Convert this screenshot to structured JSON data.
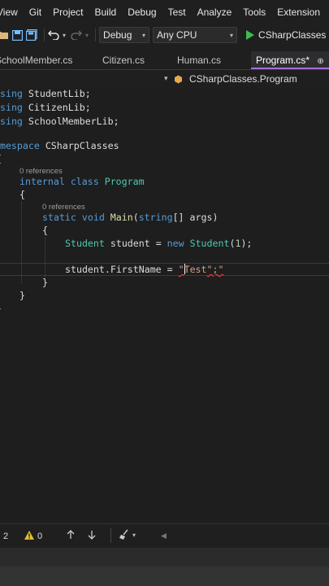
{
  "menu": [
    "View",
    "Git",
    "Project",
    "Build",
    "Debug",
    "Test",
    "Analyze",
    "Tools",
    "Extension"
  ],
  "toolbar": {
    "config": "Debug",
    "platform": "Any CPU",
    "run_target": "CSharpClasses"
  },
  "tabs": [
    {
      "label": "SchoolMember.cs",
      "active": false
    },
    {
      "label": "Citizen.cs",
      "active": false
    },
    {
      "label": "Human.cs",
      "active": false
    },
    {
      "label": "Program.cs*",
      "active": true
    }
  ],
  "tab_pin": "⊕",
  "nav": {
    "type_label": "CSharpClasses.Program"
  },
  "code": {
    "using1_kw": "using",
    "using1_ns": "StudentLib;",
    "using2_kw": "using",
    "using2_ns": "CitizenLib;",
    "using3_kw": "using",
    "using3_ns": "SchoolMemberLib;",
    "ns_kw": "namespace",
    "ns_name": "CSharpClasses",
    "open_brace_1": "{",
    "refs_class": "0 references",
    "class_mod": "internal",
    "class_kw": "class",
    "class_name": "Program",
    "open_brace_2": "{",
    "refs_method": "0 references",
    "m_static": "static",
    "m_void": "void",
    "m_name": "Main",
    "m_params_open": "(",
    "m_string": "string",
    "m_params_rest": "[] args)",
    "open_brace_3": "{",
    "l1_type": "Student",
    "l1_var": " student = ",
    "l1_new": "new",
    "l1_ctor": "Student",
    "l1_arg_open": "(",
    "l1_num": "1",
    "l1_end": ");",
    "l2_lhs": "student.FirstName = ",
    "l2_q1": "\"",
    "l2_str": "Test",
    "l2_q2": "\";\"",
    "close_brace_3": "}",
    "close_brace_2": "}",
    "close_brace_1": "}"
  },
  "status": {
    "errors": "2",
    "warnings": "0"
  },
  "colors": {
    "keyword": "#569cd6",
    "type": "#4ec9b0",
    "method": "#dcdcaa",
    "number": "#b5cea8",
    "string": "#d69d85",
    "run_green": "#3fb950",
    "active_tab_accent": "#a56fd6",
    "error": "#ff4040"
  }
}
